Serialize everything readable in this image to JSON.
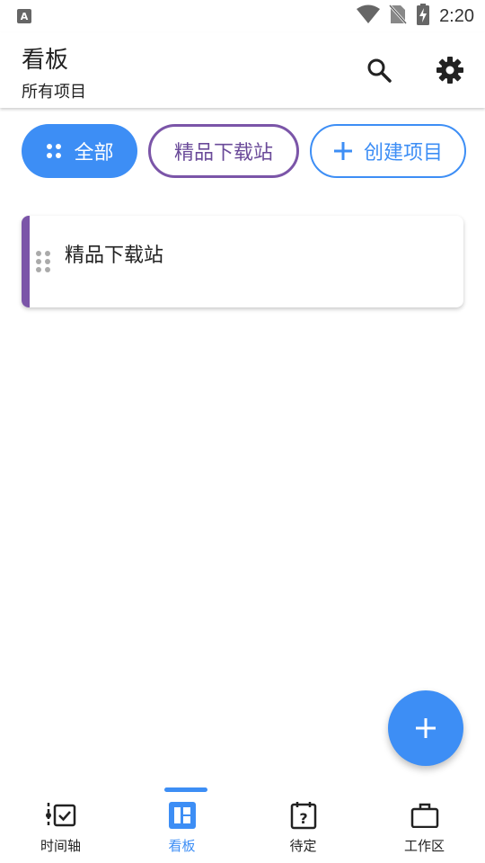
{
  "status_bar": {
    "time": "2:20",
    "icons": [
      "keyboard-a-icon",
      "wifi-icon",
      "no-sim-icon",
      "battery-charging-icon"
    ]
  },
  "app_bar": {
    "title": "看板",
    "subtitle": "所有项目",
    "actions": [
      "search-icon",
      "gear-icon"
    ]
  },
  "filters": {
    "all_label": "全部",
    "project_label": "精品下载站",
    "create_label": "创建项目"
  },
  "projects": [
    {
      "name": "精品下载站",
      "accent_color": "#7b55a8"
    }
  ],
  "fab": {
    "icon": "plus-icon"
  },
  "bottom_nav": {
    "items": [
      {
        "label": "时间轴",
        "icon": "timeline-icon"
      },
      {
        "label": "看板",
        "icon": "board-icon",
        "active": true
      },
      {
        "label": "待定",
        "icon": "pending-calendar-icon"
      },
      {
        "label": "工作区",
        "icon": "briefcase-icon"
      }
    ]
  },
  "colors": {
    "accent": "#3d8ef5",
    "project_purple": "#7b55a8"
  }
}
